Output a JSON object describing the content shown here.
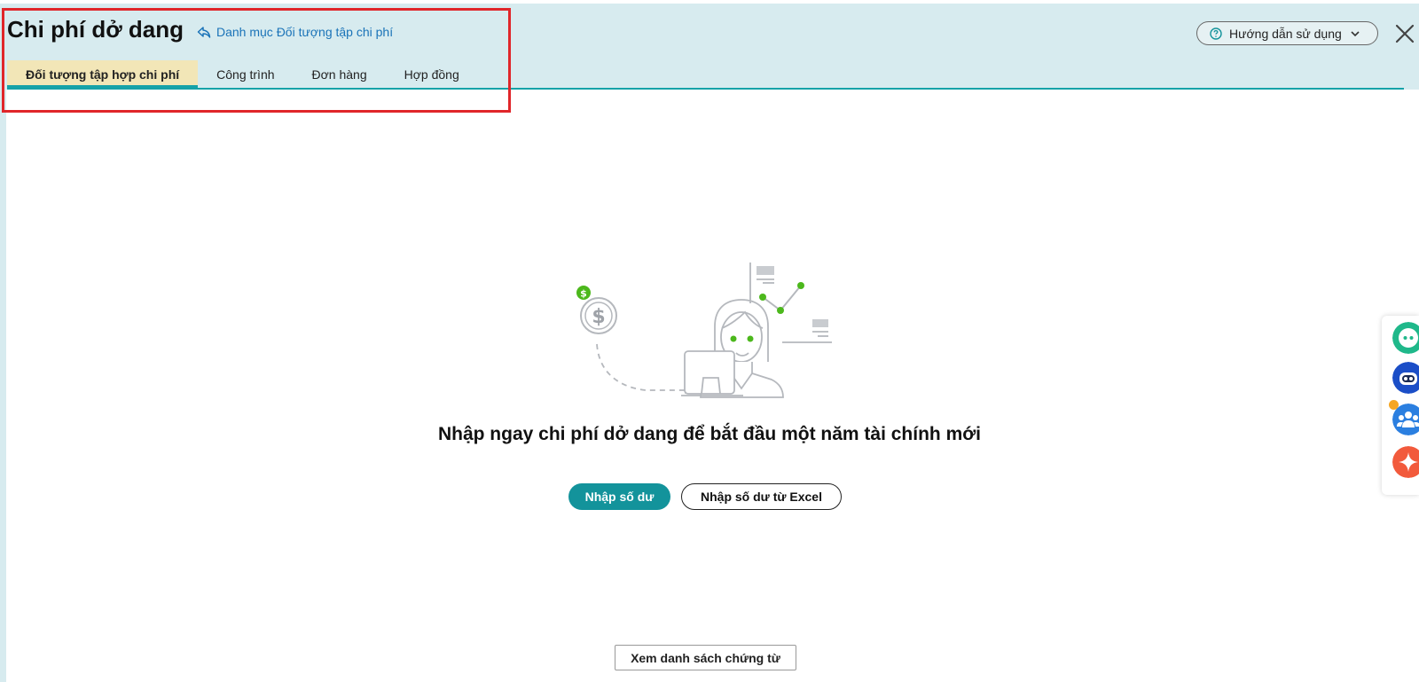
{
  "header": {
    "title": "Chi phí dở dang",
    "catalog_link": "Danh mục Đối tượng tập chi phí",
    "help_label": "Hướng dẫn sử dụng"
  },
  "tabs": [
    {
      "label": "Đối tượng tập hợp chi phí",
      "active": true
    },
    {
      "label": "Công trình",
      "active": false
    },
    {
      "label": "Đơn hàng",
      "active": false
    },
    {
      "label": "Hợp đồng",
      "active": false
    }
  ],
  "empty_state": {
    "message": "Nhập ngay chi phí dở dang để bắt đầu một năm tài chính mới",
    "primary_button": "Nhập số dư",
    "secondary_button": "Nhập số dư từ Excel"
  },
  "footer": {
    "voucher_button": "Xem danh sách chứng từ"
  },
  "side_widgets": [
    {
      "icon": "chat-bot-icon"
    },
    {
      "icon": "robot-assistant-icon"
    },
    {
      "icon": "community-icon"
    },
    {
      "icon": "ai-sparkle-icon"
    }
  ],
  "colors": {
    "header_bg": "#d7ebef",
    "accent": "#16a2a8",
    "active_tab_bg": "#f2e6b7",
    "primary_button": "#13939b",
    "link": "#1a73b8",
    "highlight_border": "#e0262a",
    "illustration_green": "#4cb81c"
  }
}
